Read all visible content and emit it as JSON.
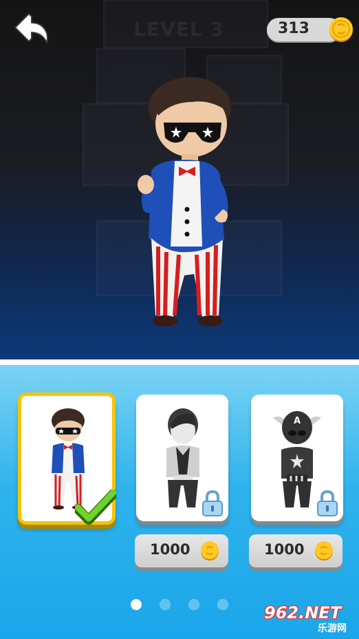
{
  "header": {
    "level_label": "LEVEL 3",
    "coins": "313"
  },
  "icons": {
    "back": "back-arrow-icon",
    "coin": "coin-icon",
    "lock": "lock-icon",
    "check": "check-icon"
  },
  "skins": [
    {
      "name": "uncle-sam",
      "selected": true,
      "locked": false
    },
    {
      "name": "plain",
      "selected": false,
      "locked": true,
      "price": "1000"
    },
    {
      "name": "captain",
      "selected": false,
      "locked": true,
      "price": "1000"
    }
  ],
  "pagination": {
    "pages": 4,
    "active": 1
  },
  "watermark": {
    "main": "962.NET",
    "sub": "乐游网"
  },
  "colors": {
    "accent_gold": "#f6c400",
    "panel_blue": "#1aa6ea",
    "check_green": "#54c21a"
  }
}
